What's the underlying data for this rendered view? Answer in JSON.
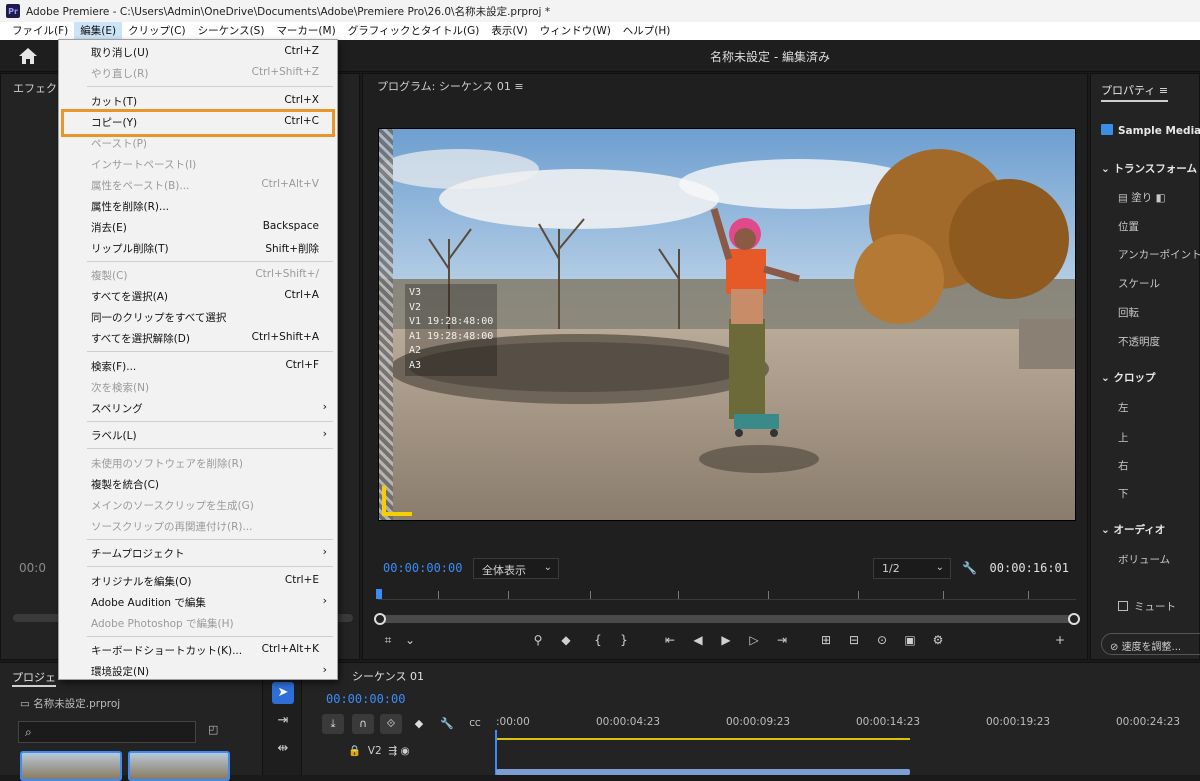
{
  "titlebar": {
    "app_icon": "Pr",
    "title": "Adobe Premiere - C:\\Users\\Admin\\OneDrive\\Documents\\Adobe\\Premiere Pro\\26.0\\名称未設定.prproj *"
  },
  "menubar": [
    "ファイル(F)",
    "編集(E)",
    "クリップ(C)",
    "シーケンス(S)",
    "マーカー(M)",
    "グラフィックとタイトル(G)",
    "表示(V)",
    "ウィンドウ(W)",
    "ヘルプ(H)"
  ],
  "header": {
    "doc_title": "名称未設定 - 編集済み"
  },
  "left_panel": {
    "tab": "エフェクト",
    "timecode": "00:0"
  },
  "program": {
    "tab": "プログラム: シーケンス 01",
    "menu_icon": "≡",
    "overlay": [
      "V3",
      "V2",
      "V1 19:28:48:00",
      "A1 19:28:48:00",
      "A2",
      "A3"
    ],
    "timecode_left": "00:00:00:00",
    "fit": "全体表示",
    "resolution": "1/2",
    "timecode_right": "00:00:16:01"
  },
  "properties": {
    "tab": "プロパティ",
    "tab_icon": "≡",
    "media": "Sample Media",
    "transform": "トランスフォーム",
    "fill": "塗り",
    "position": "位置",
    "anchor": "アンカーポイント",
    "scale": "スケール",
    "rotation": "回転",
    "opacity": "不透明度",
    "crop": "クロップ",
    "left": "左",
    "top": "上",
    "right": "右",
    "bottom": "下",
    "audio": "オーディオ",
    "volume": "ボリューム",
    "mute": "ミュート",
    "speed": "速度を調整..."
  },
  "project": {
    "tab": "プロジェ",
    "name": "名称未設定.prproj"
  },
  "timeline": {
    "tab": "シーケンス 01",
    "timecode": "00:00:00:00",
    "ruler": [
      ":00:00",
      "00:00:04:23",
      "00:00:09:23",
      "00:00:14:23",
      "00:00:19:23",
      "00:00:24:23"
    ],
    "track": "V2"
  },
  "edit_menu": {
    "items": [
      {
        "label": "取り消し(U)",
        "shortcut": "Ctrl+Z",
        "disabled": false
      },
      {
        "label": "やり直し(R)",
        "shortcut": "Ctrl+Shift+Z",
        "disabled": true
      },
      {
        "label": "カット(T)",
        "shortcut": "Ctrl+X",
        "disabled": false
      },
      {
        "label": "コピー(Y)",
        "shortcut": "Ctrl+C",
        "disabled": false
      },
      {
        "label": "ペースト(P)",
        "shortcut": "",
        "disabled": true
      },
      {
        "label": "インサートペースト(I)",
        "shortcut": "",
        "disabled": true
      },
      {
        "label": "属性をペースト(B)...",
        "shortcut": "Ctrl+Alt+V",
        "disabled": true
      },
      {
        "label": "属性を削除(R)...",
        "shortcut": "",
        "disabled": false
      },
      {
        "label": "消去(E)",
        "shortcut": "Backspace",
        "disabled": false
      },
      {
        "label": "リップル削除(T)",
        "shortcut": "Shift+削除",
        "disabled": false
      },
      {
        "label": "複製(C)",
        "shortcut": "Ctrl+Shift+/",
        "disabled": true
      },
      {
        "label": "すべてを選択(A)",
        "shortcut": "Ctrl+A",
        "disabled": false
      },
      {
        "label": "同一のクリップをすべて選択",
        "shortcut": "",
        "disabled": false
      },
      {
        "label": "すべてを選択解除(D)",
        "shortcut": "Ctrl+Shift+A",
        "disabled": false
      },
      {
        "label": "検索(F)...",
        "shortcut": "Ctrl+F",
        "disabled": false
      },
      {
        "label": "次を検索(N)",
        "shortcut": "",
        "disabled": true
      },
      {
        "label": "スペリング",
        "shortcut": "",
        "disabled": false,
        "submenu": true
      },
      {
        "label": "ラベル(L)",
        "shortcut": "",
        "disabled": false,
        "submenu": true
      },
      {
        "label": "未使用のソフトウェアを削除(R)",
        "shortcut": "",
        "disabled": true
      },
      {
        "label": "複製を統合(C)",
        "shortcut": "",
        "disabled": false
      },
      {
        "label": "メインのソースクリップを生成(G)",
        "shortcut": "",
        "disabled": true
      },
      {
        "label": "ソースクリップの再関連付け(R)...",
        "shortcut": "",
        "disabled": true
      },
      {
        "label": "チームプロジェクト",
        "shortcut": "",
        "disabled": false,
        "submenu": true
      },
      {
        "label": "オリジナルを編集(O)",
        "shortcut": "Ctrl+E",
        "disabled": false
      },
      {
        "label": "Adobe Audition で編集",
        "shortcut": "",
        "disabled": false,
        "submenu": true
      },
      {
        "label": "Adobe Photoshop で編集(H)",
        "shortcut": "",
        "disabled": true
      },
      {
        "label": "キーボードショートカット(K)...",
        "shortcut": "Ctrl+Alt+K",
        "disabled": false
      },
      {
        "label": "環境設定(N)",
        "shortcut": "",
        "disabled": false,
        "submenu": true
      }
    ]
  },
  "colors": {
    "accent": "#3d8cf5",
    "highlight": "#e8962a",
    "menu_bg": "#f2f2f2"
  }
}
